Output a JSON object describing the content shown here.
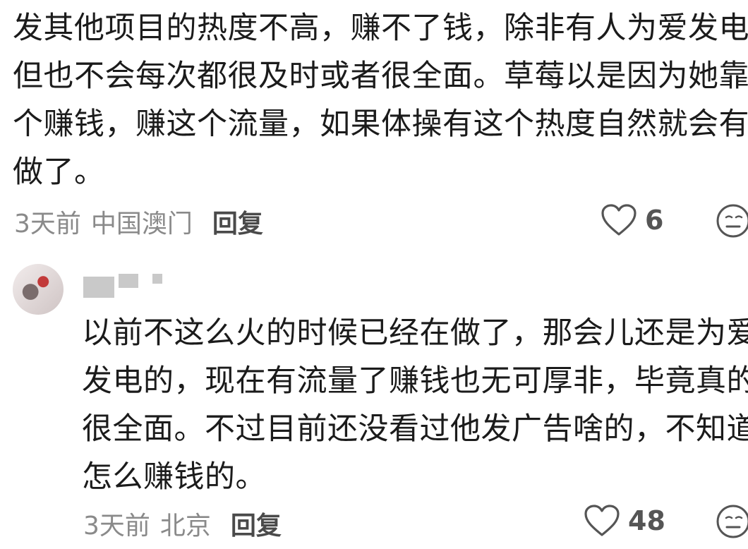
{
  "comments": [
    {
      "text_lines": [
        "发其他项目的热度不高，赚不了钱，除非有人为爱发电，",
        "但也不会每次都很及时或者很全面。草莓以是因为她靠这",
        "个赚钱，赚这个流量，如果体操有这个热度自然就会有人",
        "做了。"
      ],
      "time": "3天前",
      "location": "中国澳门",
      "reply_label": "回复",
      "like_count": "6",
      "like_icon": "heart-outline-icon",
      "dislike_icon": "meh-face-icon"
    },
    {
      "avatar_icon": "avatar",
      "username_icon": "blurred-username",
      "text_lines": [
        "以前不这么火的时候已经在做了，那会儿还是为爱",
        "发电的，现在有流量了赚钱也无可厚非，毕竟真的",
        "很全面。不过目前还没看过他发广告啥的，不知道",
        "怎么赚钱的。"
      ],
      "time": "3天前",
      "location": "北京",
      "reply_label": "回复",
      "like_count": "48",
      "like_icon": "heart-outline-icon",
      "dislike_icon": "meh-face-icon"
    }
  ]
}
